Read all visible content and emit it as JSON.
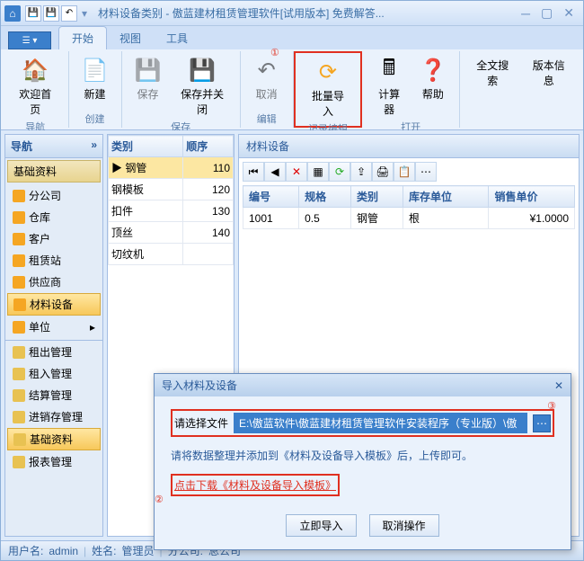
{
  "titlebar": {
    "title": "材料设备类别 - 傲蓝建材租赁管理软件[试用版本] 免费解答..."
  },
  "tabs": {
    "start": "开始",
    "view": "视图",
    "tool": "工具"
  },
  "ribbon": {
    "welcome": "欢迎首页",
    "nav_grp": "导航",
    "new": "新建",
    "create_grp": "创建",
    "save": "保存",
    "save_close": "保存并关闭",
    "save_grp": "保存",
    "cancel": "取消",
    "edit_grp": "编辑",
    "batch_import": "批量导入",
    "record_grp": "记录编辑",
    "calculator": "计算器",
    "help": "帮助",
    "open_grp": "打开",
    "fulltext": "全文搜索",
    "version": "版本信息"
  },
  "nav": {
    "title": "导航",
    "group": "基础资料",
    "items": [
      {
        "label": "分公司"
      },
      {
        "label": "仓库"
      },
      {
        "label": "客户"
      },
      {
        "label": "租赁站"
      },
      {
        "label": "供应商"
      },
      {
        "label": "材料设备",
        "sel": true
      },
      {
        "label": "单位"
      }
    ],
    "folders": [
      {
        "label": "租出管理"
      },
      {
        "label": "租入管理"
      },
      {
        "label": "结算管理"
      },
      {
        "label": "进销存管理"
      },
      {
        "label": "基础资料",
        "sel": true
      },
      {
        "label": "报表管理"
      }
    ]
  },
  "cattable": {
    "cols": [
      "类别",
      "顺序"
    ],
    "rows": [
      [
        "钢管",
        "110"
      ],
      [
        "钢模板",
        "120"
      ],
      [
        "扣件",
        "130"
      ],
      [
        "顶丝",
        "140"
      ],
      [
        "切纹机",
        ""
      ]
    ]
  },
  "main": {
    "title": "材料设备",
    "cols": [
      "编号",
      "规格",
      "类别",
      "库存单位",
      "销售单价"
    ],
    "rows": [
      [
        "1001",
        "0.5",
        "钢管",
        "根",
        "¥1.0000"
      ]
    ]
  },
  "dialog": {
    "title": "导入材料及设备",
    "label_file": "请选择文件",
    "path": "E:\\傲蓝软件\\傲蓝建材租赁管理软件安装程序（专业版）\\傲",
    "hint": "请将数据整理并添加到《材料及设备导入模板》后，上传即可。",
    "link": "点击下载《材料及设备导入模板》",
    "btn_import": "立即导入",
    "btn_cancel": "取消操作"
  },
  "annot": {
    "a1": "①",
    "a2": "②",
    "a3": "③"
  },
  "status": {
    "user_lbl": "用户名:",
    "user": "admin",
    "name_lbl": "姓名:",
    "name": "管理员",
    "branch_lbl": "分公司:",
    "branch": "总公司"
  }
}
